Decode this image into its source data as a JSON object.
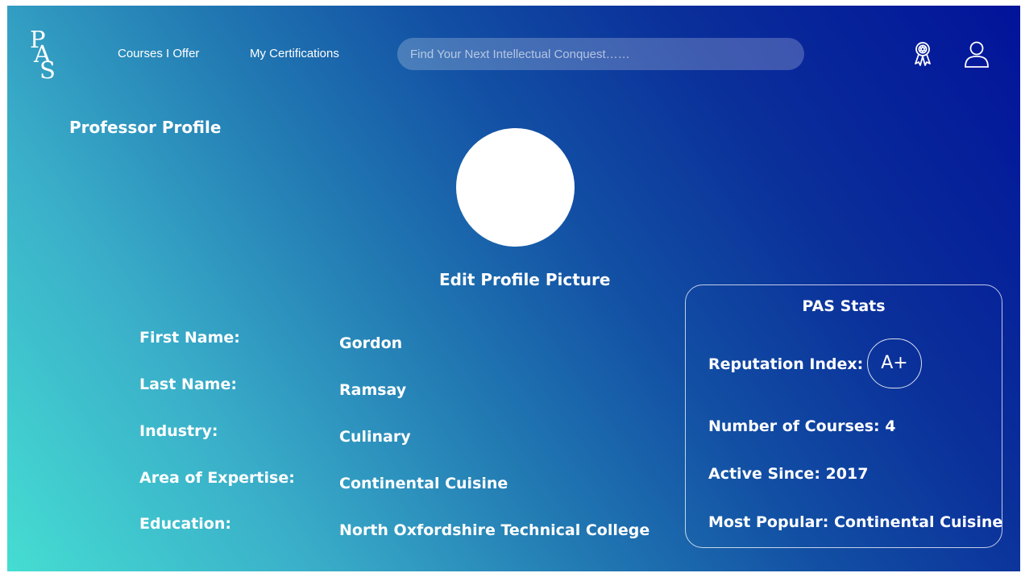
{
  "header": {
    "logo": [
      "P",
      "A",
      "S"
    ],
    "nav": [
      {
        "label": "Courses I Offer"
      },
      {
        "label": "My Certifications"
      }
    ],
    "search": {
      "placeholder": "Find Your Next Intellectual Conquest……",
      "value": ""
    },
    "icons": [
      "award-ribbon-icon",
      "user-icon"
    ]
  },
  "profile": {
    "title": "Professor Profile",
    "edit_picture_label": "Edit Profile Picture",
    "fields": [
      {
        "label": "First Name:",
        "value": "Gordon"
      },
      {
        "label": "Last Name:",
        "value": "Ramsay"
      },
      {
        "label": "Industry:",
        "value": "Culinary"
      },
      {
        "label": "Area of Expertise:",
        "value": "Continental Cuisine"
      },
      {
        "label": "Education:",
        "value": "North Oxfordshire Technical College"
      }
    ]
  },
  "stats": {
    "title": "PAS Stats",
    "reputation_label": "Reputation Index:",
    "reputation_value": "A+",
    "courses": "Number of Courses: 4",
    "active_since": "Active Since: 2017",
    "most_popular": "Most Popular: Continental Cuisine"
  },
  "colors": {
    "gradient_start": "#45ddd2",
    "gradient_mid": "#2178b2",
    "gradient_end": "#02139a",
    "text": "#ffffff"
  }
}
